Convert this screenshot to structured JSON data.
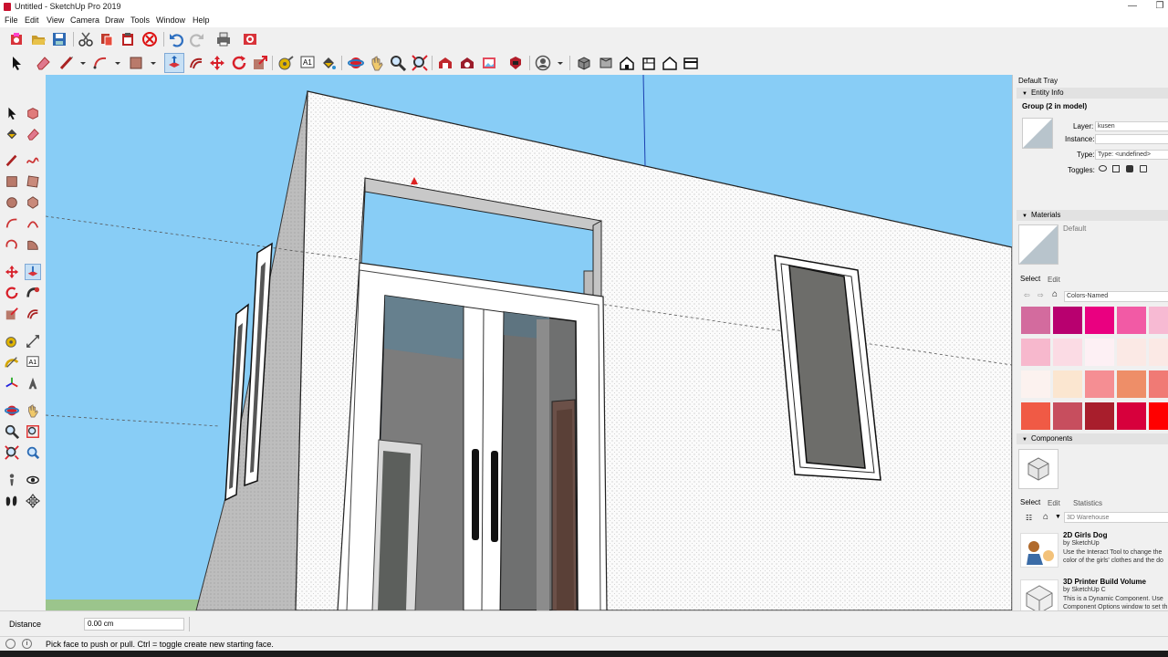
{
  "window": {
    "title": "Untitled - SketchUp Pro 2019",
    "minimize": "—",
    "restore": "❐"
  },
  "menu": [
    "File",
    "Edit",
    "View",
    "Camera",
    "Draw",
    "Tools",
    "Window",
    "Help"
  ],
  "toolbar_top": [
    "new-icon",
    "open-icon",
    "save-icon",
    "cut-icon",
    "copy-icon",
    "paste-icon",
    "erase-icon",
    "undo-icon",
    "redo-icon",
    "print-icon",
    "model-info-icon"
  ],
  "toolbar_main": [
    "select-icon",
    "eraser-icon",
    "line-icon",
    "arc-icon",
    "rectangle-icon",
    "push-pull-icon",
    "move-icon",
    "rotate-icon",
    "scale-icon",
    "offset-icon",
    "tape-measure-icon",
    "text-icon",
    "paint-bucket-icon",
    "orbit-icon",
    "pan-icon",
    "zoom-icon",
    "zoom-extents-icon",
    "3d-warehouse-icon",
    "extension-warehouse-icon",
    "layout-icon",
    "extension-manager-icon",
    "account-icon",
    "iso-view-icon",
    "top-view-icon",
    "front-view-icon",
    "right-view-icon",
    "back-view-icon",
    "left-view-icon"
  ],
  "measurements": {
    "label": "Distance",
    "value": "0.00 cm"
  },
  "status": {
    "hint": "Pick face to push or pull.  Ctrl = toggle create new starting face."
  },
  "tray": {
    "title": "Default Tray",
    "entity_info": {
      "header": "Entity Info",
      "selection": "Group (2 in model)",
      "layer_label": "Layer:",
      "layer_value": "kusen",
      "instance_label": "Instance:",
      "instance_value": "",
      "type_label": "Type:",
      "type_value": "Type: <undefined>",
      "toggles_label": "Toggles:"
    },
    "materials": {
      "header": "Materials",
      "current": "Default",
      "tab_select": "Select",
      "tab_edit": "Edit",
      "library": "Colors-Named",
      "swatches": [
        "#d36b9e",
        "#b8006f",
        "#ea0080",
        "#f25aa5",
        "#f7bad3",
        "#f7b8cd",
        "#fbdbe4",
        "#fdf0f4",
        "#fbe9e5",
        "#fbe9e5",
        "#fcf2ef",
        "#fbe6d0",
        "#f58e93",
        "#ee8e68",
        "#f07a75",
        "#f05a45",
        "#c74e5e",
        "#a81e2c",
        "#d7003c",
        "#ff0000"
      ]
    },
    "components": {
      "header": "Components",
      "tab_select": "Select",
      "tab_edit": "Edit",
      "tab_statistics": "Statistics",
      "search_placeholder": "3D Warehouse",
      "items": [
        {
          "title": "2D Girls Dog",
          "by": "by SketchUp",
          "desc1": "Use the Interact Tool to change the",
          "desc2": "color of the girls' clothes and the do"
        },
        {
          "title": "3D Printer Build Volume",
          "by": "by SketchUp C",
          "desc1": "This is a Dynamic Component. Use",
          "desc2": "Component Options window to set th"
        }
      ]
    }
  }
}
